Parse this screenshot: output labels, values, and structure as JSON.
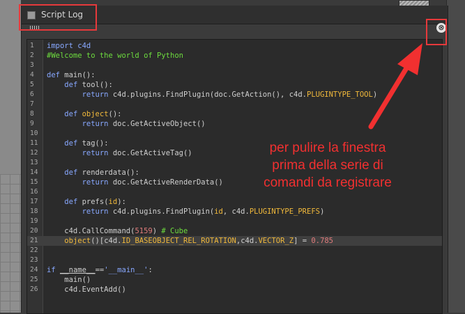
{
  "window": {
    "title": "Script Log",
    "close_glyph": "⊗"
  },
  "annotation": {
    "lines": [
      "per pulire la finestra",
      "prima della serie di",
      "comandi da registrare"
    ],
    "color": "#f13030"
  },
  "editor": {
    "lines": [
      {
        "n": "1",
        "segs": [
          {
            "t": "import c4d",
            "c": "kw"
          }
        ]
      },
      {
        "n": "2",
        "segs": [
          {
            "t": "#Welcome to the world of Python",
            "c": "cmt"
          }
        ]
      },
      {
        "n": "3",
        "segs": []
      },
      {
        "n": "4",
        "segs": [
          {
            "t": "def",
            "c": "kw"
          },
          {
            "t": " main():",
            "c": ""
          }
        ]
      },
      {
        "n": "5",
        "segs": [
          {
            "t": "    ",
            "c": ""
          },
          {
            "t": "def",
            "c": "kw"
          },
          {
            "t": " tool():",
            "c": ""
          }
        ]
      },
      {
        "n": "6",
        "segs": [
          {
            "t": "        ",
            "c": ""
          },
          {
            "t": "return",
            "c": "kw"
          },
          {
            "t": " c4d.plugins.FindPlugin(doc.GetAction(), c4d.",
            "c": ""
          },
          {
            "t": "PLUGINTYPE_TOOL",
            "c": "const"
          },
          {
            "t": ")",
            "c": ""
          }
        ]
      },
      {
        "n": "7",
        "segs": []
      },
      {
        "n": "8",
        "segs": [
          {
            "t": "    ",
            "c": ""
          },
          {
            "t": "def",
            "c": "kw"
          },
          {
            "t": " ",
            "c": ""
          },
          {
            "t": "object",
            "c": "const"
          },
          {
            "t": "():",
            "c": ""
          }
        ]
      },
      {
        "n": "9",
        "segs": [
          {
            "t": "        ",
            "c": ""
          },
          {
            "t": "return",
            "c": "kw"
          },
          {
            "t": " doc.GetActiveObject()",
            "c": ""
          }
        ]
      },
      {
        "n": "10",
        "segs": []
      },
      {
        "n": "11",
        "segs": [
          {
            "t": "    ",
            "c": ""
          },
          {
            "t": "def",
            "c": "kw"
          },
          {
            "t": " tag():",
            "c": ""
          }
        ]
      },
      {
        "n": "12",
        "segs": [
          {
            "t": "        ",
            "c": ""
          },
          {
            "t": "return",
            "c": "kw"
          },
          {
            "t": " doc.GetActiveTag()",
            "c": ""
          }
        ]
      },
      {
        "n": "13",
        "segs": []
      },
      {
        "n": "14",
        "segs": [
          {
            "t": "    ",
            "c": ""
          },
          {
            "t": "def",
            "c": "kw"
          },
          {
            "t": " renderdata():",
            "c": ""
          }
        ]
      },
      {
        "n": "15",
        "segs": [
          {
            "t": "        ",
            "c": ""
          },
          {
            "t": "return",
            "c": "kw"
          },
          {
            "t": " doc.GetActiveRenderData()",
            "c": ""
          }
        ]
      },
      {
        "n": "16",
        "segs": []
      },
      {
        "n": "17",
        "segs": [
          {
            "t": "    ",
            "c": ""
          },
          {
            "t": "def",
            "c": "kw"
          },
          {
            "t": " prefs(",
            "c": ""
          },
          {
            "t": "id",
            "c": "const"
          },
          {
            "t": "):",
            "c": ""
          }
        ]
      },
      {
        "n": "18",
        "segs": [
          {
            "t": "        ",
            "c": ""
          },
          {
            "t": "return",
            "c": "kw"
          },
          {
            "t": " c4d.plugins.FindPlugin(",
            "c": ""
          },
          {
            "t": "id",
            "c": "const"
          },
          {
            "t": ", c4d.",
            "c": ""
          },
          {
            "t": "PLUGINTYPE_PREFS",
            "c": "const"
          },
          {
            "t": ")",
            "c": ""
          }
        ]
      },
      {
        "n": "19",
        "segs": []
      },
      {
        "n": "20",
        "segs": [
          {
            "t": "    c4d.CallCommand(",
            "c": ""
          },
          {
            "t": "5159",
            "c": "num"
          },
          {
            "t": ") ",
            "c": ""
          },
          {
            "t": "# Cube",
            "c": "cmt"
          }
        ]
      },
      {
        "n": "21",
        "segs": [
          {
            "t": "    ",
            "c": ""
          },
          {
            "t": "object",
            "c": "const"
          },
          {
            "t": "()[c4d.",
            "c": ""
          },
          {
            "t": "ID_BASEOBJECT_REL_ROTATION",
            "c": "const"
          },
          {
            "t": ",c4d.",
            "c": ""
          },
          {
            "t": "VECTOR_Z",
            "c": "const"
          },
          {
            "t": "] = ",
            "c": ""
          },
          {
            "t": "0.785",
            "c": "num"
          }
        ]
      },
      {
        "n": "22",
        "segs": []
      },
      {
        "n": "23",
        "segs": []
      },
      {
        "n": "24",
        "segs": [
          {
            "t": "if",
            "c": "kw"
          },
          {
            "t": " ",
            "c": ""
          },
          {
            "t": "__name__",
            "c": "under"
          },
          {
            "t": "==",
            "c": ""
          },
          {
            "t": "'__main__'",
            "c": "kw"
          },
          {
            "t": ":",
            "c": ""
          }
        ]
      },
      {
        "n": "25",
        "segs": [
          {
            "t": "    main()",
            "c": ""
          }
        ]
      },
      {
        "n": "26",
        "segs": [
          {
            "t": "    c4d.EventAdd()",
            "c": ""
          }
        ]
      }
    ],
    "current_line": "21"
  }
}
